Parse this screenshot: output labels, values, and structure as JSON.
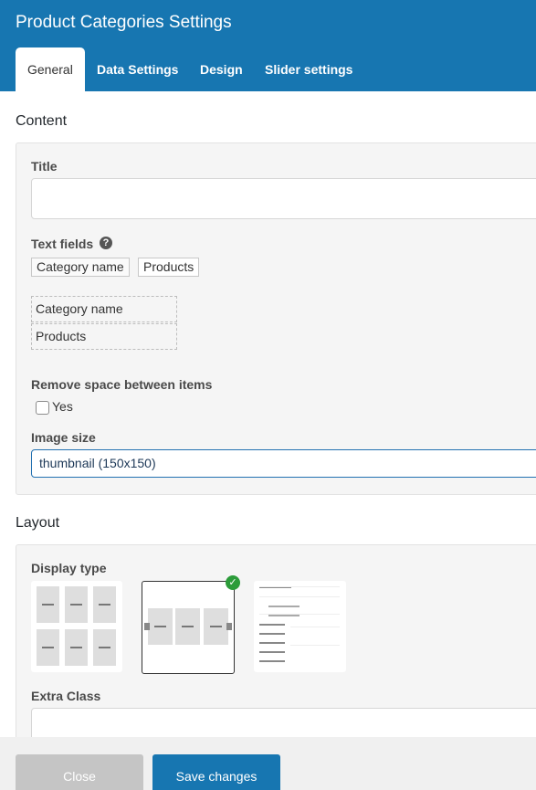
{
  "header": {
    "title": "Product Categories Settings",
    "tabs": [
      {
        "label": "General",
        "active": true
      },
      {
        "label": "Data Settings"
      },
      {
        "label": "Design"
      },
      {
        "label": "Slider settings"
      }
    ]
  },
  "content_section": {
    "heading": "Content",
    "title_label": "Title",
    "title_value": "",
    "text_fields_label": "Text fields",
    "help_glyph": "?",
    "chips": [
      "Category name",
      "Products"
    ],
    "sortable_fields": [
      "Category name",
      "Products"
    ],
    "remove_space_label": "Remove space between items",
    "remove_space_option": "Yes",
    "remove_space_checked": false,
    "image_size_label": "Image size",
    "image_size_value": "thumbnail (150x150)"
  },
  "layout_section": {
    "heading": "Layout",
    "display_type_label": "Display type",
    "display_types": [
      "grid",
      "slider",
      "list"
    ],
    "selected_display_type": "slider",
    "extra_class_label": "Extra Class",
    "extra_class_value": ""
  },
  "footer": {
    "close_label": "Close",
    "save_label": "Save changes"
  },
  "colors": {
    "brand": "#1776b1",
    "check": "#2c9c3a"
  }
}
